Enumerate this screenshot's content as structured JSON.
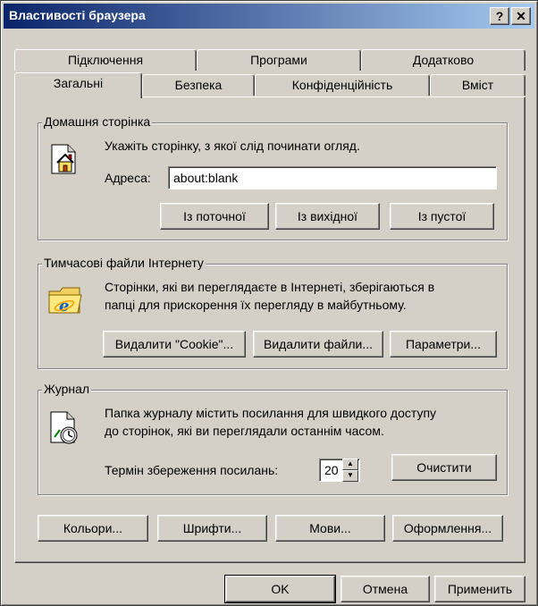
{
  "window": {
    "title": "Властивості браузера",
    "help_label": "?",
    "close_label": "✕"
  },
  "tabs": {
    "back_row": [
      {
        "label": "Підключення"
      },
      {
        "label": "Програми"
      },
      {
        "label": "Додатково"
      }
    ],
    "front_row": [
      {
        "label": "Загальні",
        "active": true
      },
      {
        "label": "Безпека"
      },
      {
        "label": "Конфіденційність"
      },
      {
        "label": "Вміст"
      }
    ]
  },
  "home_page": {
    "legend": "Домашня сторінка",
    "description": "Укажіть сторінку, з якої слід починати огляд.",
    "address_label": "Адреса:",
    "address_value": "about:blank",
    "btn_current": "Із поточної",
    "btn_default": "Із вихідної",
    "btn_blank": "Із пустої",
    "icon": "home-page-icon"
  },
  "temp_files": {
    "legend": "Тимчасові файли Інтернету",
    "description_line1": "Сторінки, які ви переглядаєте в Інтернеті, зберігаються в",
    "description_line2": "папці для прискорення їх перегляду в майбутньому.",
    "btn_cookies": "Видалити \"Cookie\"...",
    "btn_files": "Видалити файли...",
    "btn_settings": "Параметри...",
    "icon": "ie-folder-icon"
  },
  "history": {
    "legend": "Журнал",
    "description_line1": "Папка журналу містить посилання для швидкого доступу",
    "description_line2": "до сторінок, які ви переглядали останнім часом.",
    "days_label": "Термін збереження посилань:",
    "days_value": "20",
    "btn_clear": "Очистити",
    "icon": "history-icon"
  },
  "bottom_buttons": {
    "colors": "Кольори...",
    "fonts": "Шрифти...",
    "languages": "Мови...",
    "accessibility": "Оформлення..."
  },
  "dialog_buttons": {
    "ok": "OK",
    "cancel": "Отмена",
    "apply": "Применить"
  }
}
